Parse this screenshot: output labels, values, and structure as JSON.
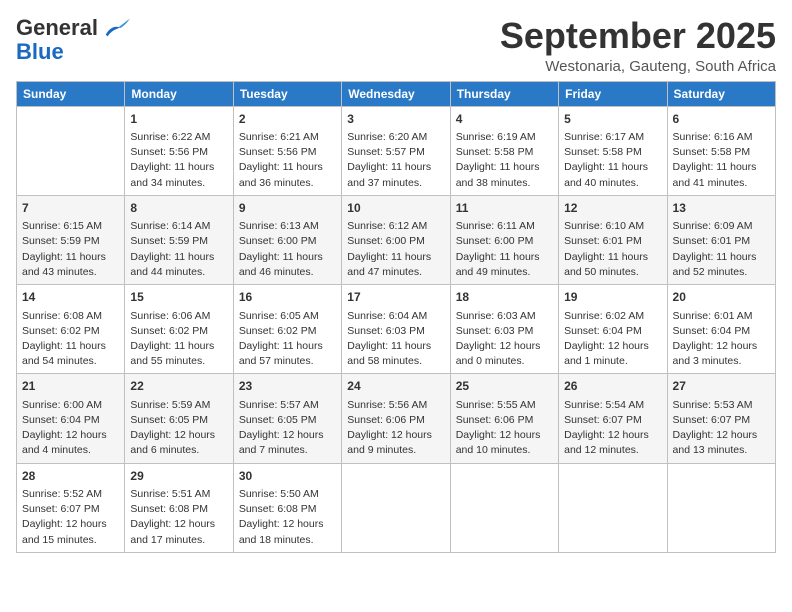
{
  "header": {
    "logo_general": "General",
    "logo_blue": "Blue",
    "month_title": "September 2025",
    "subtitle": "Westonaria, Gauteng, South Africa"
  },
  "calendar": {
    "days_of_week": [
      "Sunday",
      "Monday",
      "Tuesday",
      "Wednesday",
      "Thursday",
      "Friday",
      "Saturday"
    ],
    "weeks": [
      [
        {
          "day": "",
          "info": ""
        },
        {
          "day": "1",
          "info": "Sunrise: 6:22 AM\nSunset: 5:56 PM\nDaylight: 11 hours\nand 34 minutes."
        },
        {
          "day": "2",
          "info": "Sunrise: 6:21 AM\nSunset: 5:56 PM\nDaylight: 11 hours\nand 36 minutes."
        },
        {
          "day": "3",
          "info": "Sunrise: 6:20 AM\nSunset: 5:57 PM\nDaylight: 11 hours\nand 37 minutes."
        },
        {
          "day": "4",
          "info": "Sunrise: 6:19 AM\nSunset: 5:58 PM\nDaylight: 11 hours\nand 38 minutes."
        },
        {
          "day": "5",
          "info": "Sunrise: 6:17 AM\nSunset: 5:58 PM\nDaylight: 11 hours\nand 40 minutes."
        },
        {
          "day": "6",
          "info": "Sunrise: 6:16 AM\nSunset: 5:58 PM\nDaylight: 11 hours\nand 41 minutes."
        }
      ],
      [
        {
          "day": "7",
          "info": "Sunrise: 6:15 AM\nSunset: 5:59 PM\nDaylight: 11 hours\nand 43 minutes."
        },
        {
          "day": "8",
          "info": "Sunrise: 6:14 AM\nSunset: 5:59 PM\nDaylight: 11 hours\nand 44 minutes."
        },
        {
          "day": "9",
          "info": "Sunrise: 6:13 AM\nSunset: 6:00 PM\nDaylight: 11 hours\nand 46 minutes."
        },
        {
          "day": "10",
          "info": "Sunrise: 6:12 AM\nSunset: 6:00 PM\nDaylight: 11 hours\nand 47 minutes."
        },
        {
          "day": "11",
          "info": "Sunrise: 6:11 AM\nSunset: 6:00 PM\nDaylight: 11 hours\nand 49 minutes."
        },
        {
          "day": "12",
          "info": "Sunrise: 6:10 AM\nSunset: 6:01 PM\nDaylight: 11 hours\nand 50 minutes."
        },
        {
          "day": "13",
          "info": "Sunrise: 6:09 AM\nSunset: 6:01 PM\nDaylight: 11 hours\nand 52 minutes."
        }
      ],
      [
        {
          "day": "14",
          "info": "Sunrise: 6:08 AM\nSunset: 6:02 PM\nDaylight: 11 hours\nand 54 minutes."
        },
        {
          "day": "15",
          "info": "Sunrise: 6:06 AM\nSunset: 6:02 PM\nDaylight: 11 hours\nand 55 minutes."
        },
        {
          "day": "16",
          "info": "Sunrise: 6:05 AM\nSunset: 6:02 PM\nDaylight: 11 hours\nand 57 minutes."
        },
        {
          "day": "17",
          "info": "Sunrise: 6:04 AM\nSunset: 6:03 PM\nDaylight: 11 hours\nand 58 minutes."
        },
        {
          "day": "18",
          "info": "Sunrise: 6:03 AM\nSunset: 6:03 PM\nDaylight: 12 hours\nand 0 minutes."
        },
        {
          "day": "19",
          "info": "Sunrise: 6:02 AM\nSunset: 6:04 PM\nDaylight: 12 hours\nand 1 minute."
        },
        {
          "day": "20",
          "info": "Sunrise: 6:01 AM\nSunset: 6:04 PM\nDaylight: 12 hours\nand 3 minutes."
        }
      ],
      [
        {
          "day": "21",
          "info": "Sunrise: 6:00 AM\nSunset: 6:04 PM\nDaylight: 12 hours\nand 4 minutes."
        },
        {
          "day": "22",
          "info": "Sunrise: 5:59 AM\nSunset: 6:05 PM\nDaylight: 12 hours\nand 6 minutes."
        },
        {
          "day": "23",
          "info": "Sunrise: 5:57 AM\nSunset: 6:05 PM\nDaylight: 12 hours\nand 7 minutes."
        },
        {
          "day": "24",
          "info": "Sunrise: 5:56 AM\nSunset: 6:06 PM\nDaylight: 12 hours\nand 9 minutes."
        },
        {
          "day": "25",
          "info": "Sunrise: 5:55 AM\nSunset: 6:06 PM\nDaylight: 12 hours\nand 10 minutes."
        },
        {
          "day": "26",
          "info": "Sunrise: 5:54 AM\nSunset: 6:07 PM\nDaylight: 12 hours\nand 12 minutes."
        },
        {
          "day": "27",
          "info": "Sunrise: 5:53 AM\nSunset: 6:07 PM\nDaylight: 12 hours\nand 13 minutes."
        }
      ],
      [
        {
          "day": "28",
          "info": "Sunrise: 5:52 AM\nSunset: 6:07 PM\nDaylight: 12 hours\nand 15 minutes."
        },
        {
          "day": "29",
          "info": "Sunrise: 5:51 AM\nSunset: 6:08 PM\nDaylight: 12 hours\nand 17 minutes."
        },
        {
          "day": "30",
          "info": "Sunrise: 5:50 AM\nSunset: 6:08 PM\nDaylight: 12 hours\nand 18 minutes."
        },
        {
          "day": "",
          "info": ""
        },
        {
          "day": "",
          "info": ""
        },
        {
          "day": "",
          "info": ""
        },
        {
          "day": "",
          "info": ""
        }
      ]
    ]
  }
}
